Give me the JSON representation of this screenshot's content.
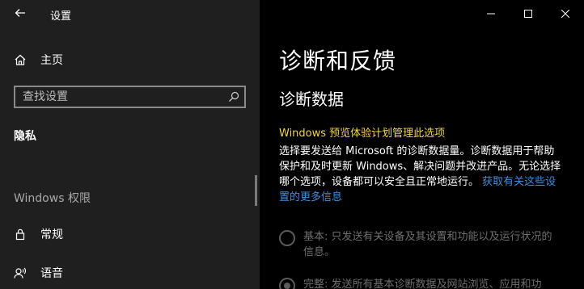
{
  "window": {
    "title": "设置",
    "controls": {
      "minimize": "minimize-icon",
      "maximize": "maximize-icon",
      "close": "close-icon"
    }
  },
  "sidebar": {
    "back_icon": "back-arrow-icon",
    "home": {
      "label": "主页",
      "icon": "home-icon"
    },
    "search": {
      "placeholder": "查找设置",
      "icon": "search-icon"
    },
    "category": "隐私",
    "section_header": "Windows 权限",
    "items": [
      {
        "label": "常规",
        "icon": "lock-icon"
      },
      {
        "label": "语音",
        "icon": "speech-icon"
      }
    ]
  },
  "main": {
    "title": "诊断和反馈",
    "subtitle": "诊断数据",
    "notice": "Windows 预览体验计划管理此选项",
    "description": "选择要发送给 Microsoft 的诊断数据量。诊断数据用于帮助保护和及时更新 Windows、解决问题并改进产品。无论选择哪个选项，设备都可以安全且正常地运行。",
    "link": "获取有关这些设置的更多信息",
    "options": [
      {
        "label": "基本: 只发送有关设备及其设置和功能以及运行状况的信息。",
        "selected": false
      },
      {
        "label": "完整: 发送所有基本诊断数据及网站浏览、应用和功",
        "selected": true
      }
    ]
  },
  "colors": {
    "sidebar_bg": "#1f1f1f",
    "main_bg": "#000000",
    "notice": "#f3d543",
    "link": "#3f8ede",
    "disabled": "#6e6e6e"
  }
}
